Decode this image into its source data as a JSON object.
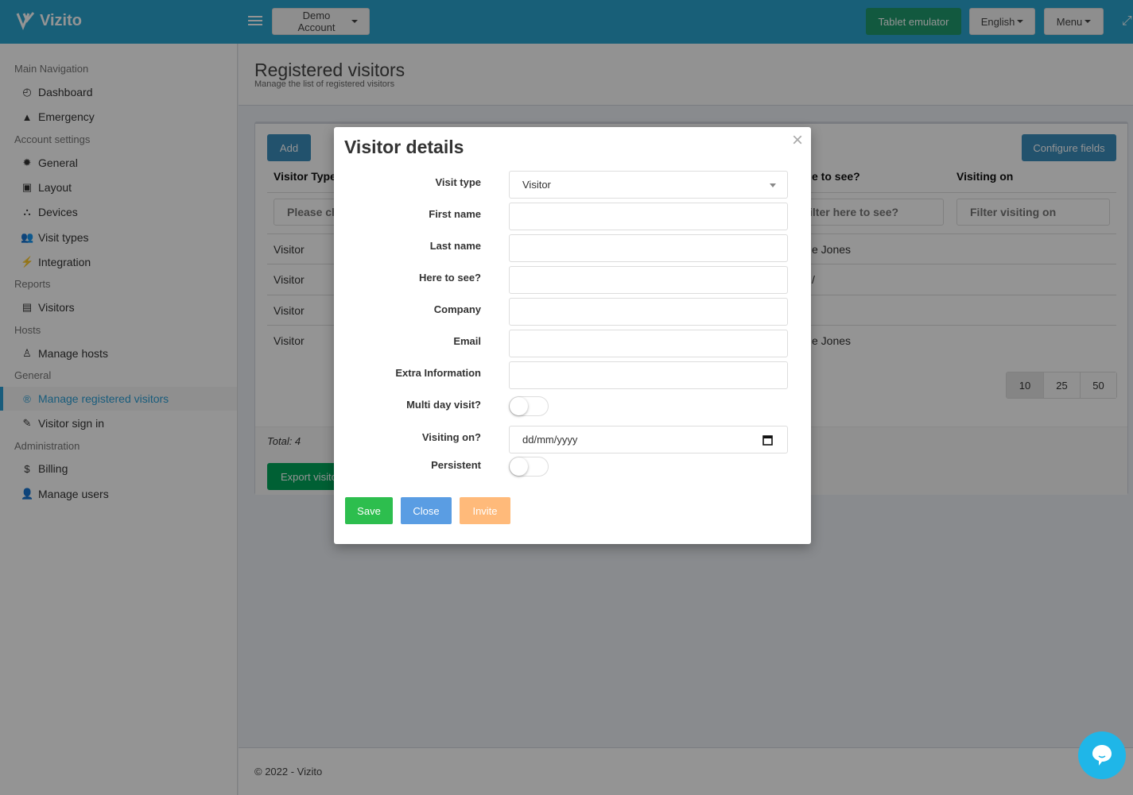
{
  "app": {
    "brand": "Vizito",
    "account_label": "Demo Account",
    "tablet_label": "Tablet emulator",
    "language_label": "English",
    "menu_label": "Menu"
  },
  "sidebar": {
    "sections": [
      {
        "header": "Main Navigation",
        "items": [
          {
            "label": "Dashboard",
            "icon": "dashboard-icon"
          },
          {
            "label": "Emergency",
            "icon": "warning-icon"
          }
        ]
      },
      {
        "header": "Account settings",
        "items": [
          {
            "label": "General",
            "icon": "gear-icon"
          },
          {
            "label": "Layout",
            "icon": "image-icon"
          },
          {
            "label": "Devices",
            "icon": "sitemap-icon"
          },
          {
            "label": "Visit types",
            "icon": "users-icon"
          },
          {
            "label": "Integration",
            "icon": "plug-icon"
          }
        ]
      },
      {
        "header": "Reports",
        "items": [
          {
            "label": "Visitors",
            "icon": "book-icon"
          }
        ]
      },
      {
        "header": "Hosts",
        "items": [
          {
            "label": "Manage hosts",
            "icon": "host-icon"
          }
        ]
      },
      {
        "header": "General",
        "items": [
          {
            "label": "Manage registered visitors",
            "icon": "registered-icon",
            "active": true
          },
          {
            "label": "Visitor sign in",
            "icon": "pencil-icon"
          }
        ]
      },
      {
        "header": "Administration",
        "items": [
          {
            "label": "Billing",
            "icon": "dollar-icon"
          },
          {
            "label": "Manage users",
            "icon": "user-plus-icon"
          }
        ]
      }
    ]
  },
  "page": {
    "title": "Registered visitors",
    "subtitle": "Manage the list of registered visitors",
    "add_label": "Add",
    "configure_label": "Configure fields",
    "columns": [
      "Visitor Type",
      "Here to see?",
      "Visiting on"
    ],
    "column_partial": "e to see?",
    "filters": {
      "visitor_type_placeholder": "Please ch",
      "here_to_see_placeholder": "ilter here to see?",
      "visiting_on_placeholder": "Filter visiting on"
    },
    "rows": [
      {
        "visitor_type": "Visitor",
        "here_to_see": "e Jones",
        "visiting_on": ""
      },
      {
        "visitor_type": "Visitor",
        "here_to_see": "/",
        "visiting_on": ""
      },
      {
        "visitor_type": "Visitor",
        "here_to_see": "",
        "visiting_on": ""
      },
      {
        "visitor_type": "Visitor",
        "here_to_see": "e Jones",
        "visiting_on": ""
      }
    ],
    "page_sizes": [
      "10",
      "25",
      "50"
    ],
    "selected_page_size": "10",
    "total_label": "Total: 4",
    "export_label": "Export visito",
    "footer": "© 2022 - Vizito"
  },
  "modal": {
    "title": "Visitor details",
    "fields": {
      "visit_type": {
        "label": "Visit type",
        "value": "Visitor"
      },
      "first_name": {
        "label": "First name",
        "value": ""
      },
      "last_name": {
        "label": "Last name",
        "value": ""
      },
      "here_to_see": {
        "label": "Here to see?",
        "value": ""
      },
      "company": {
        "label": "Company",
        "value": ""
      },
      "email": {
        "label": "Email",
        "value": ""
      },
      "extra_information": {
        "label": "Extra Information",
        "value": ""
      },
      "multi_day_visit": {
        "label": "Multi day visit?",
        "on": false
      },
      "visiting_on": {
        "label": "Visiting on?",
        "placeholder": "dd/mm/yyyy"
      },
      "persistent": {
        "label": "Persistent",
        "on": false
      }
    },
    "buttons": {
      "save": "Save",
      "close": "Close",
      "invite": "Invite"
    }
  },
  "colors": {
    "topbar": "#2aa4cf",
    "save": "#2dbe4e",
    "close": "#5a9de3",
    "invite": "#ffba7a",
    "chat": "#1fb6e8"
  }
}
